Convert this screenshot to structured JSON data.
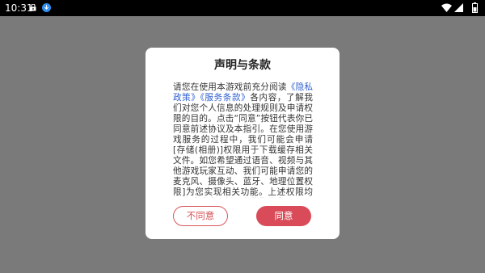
{
  "status_bar": {
    "time": "10:31",
    "icons": [
      "lock-icon",
      "download-icon",
      "wifi-icon",
      "signal-icon",
      "battery-icon"
    ]
  },
  "dialog": {
    "title": "声明与条款",
    "body": {
      "intro": "请您在使用本游戏前充分阅读",
      "link_privacy": "《隐私政策》",
      "link_terms": "《服务条款》",
      "main": "各内容，了解我们对您个人信息的处理规则及申请权限的目的。点击“同意”按钮代表你已同意前述协议及本指引。在您使用游戏服务的过程中，我们可能会申请[存储(相册)]权限用于下载缓存相关文件。如您希望通过语音、视频与其他游戏玩家互动、我们可能申请您的麦克风、摄像头、蓝牙、地理位置权限]为您实现相关功能。上述权限均不会默认或强制开启收集信息。"
    },
    "buttons": {
      "disagree": "不同意",
      "agree": "同意"
    }
  },
  "colors": {
    "overlay": "#7a7a7a",
    "accent": "#d94b58",
    "link": "#2f5fd0"
  }
}
